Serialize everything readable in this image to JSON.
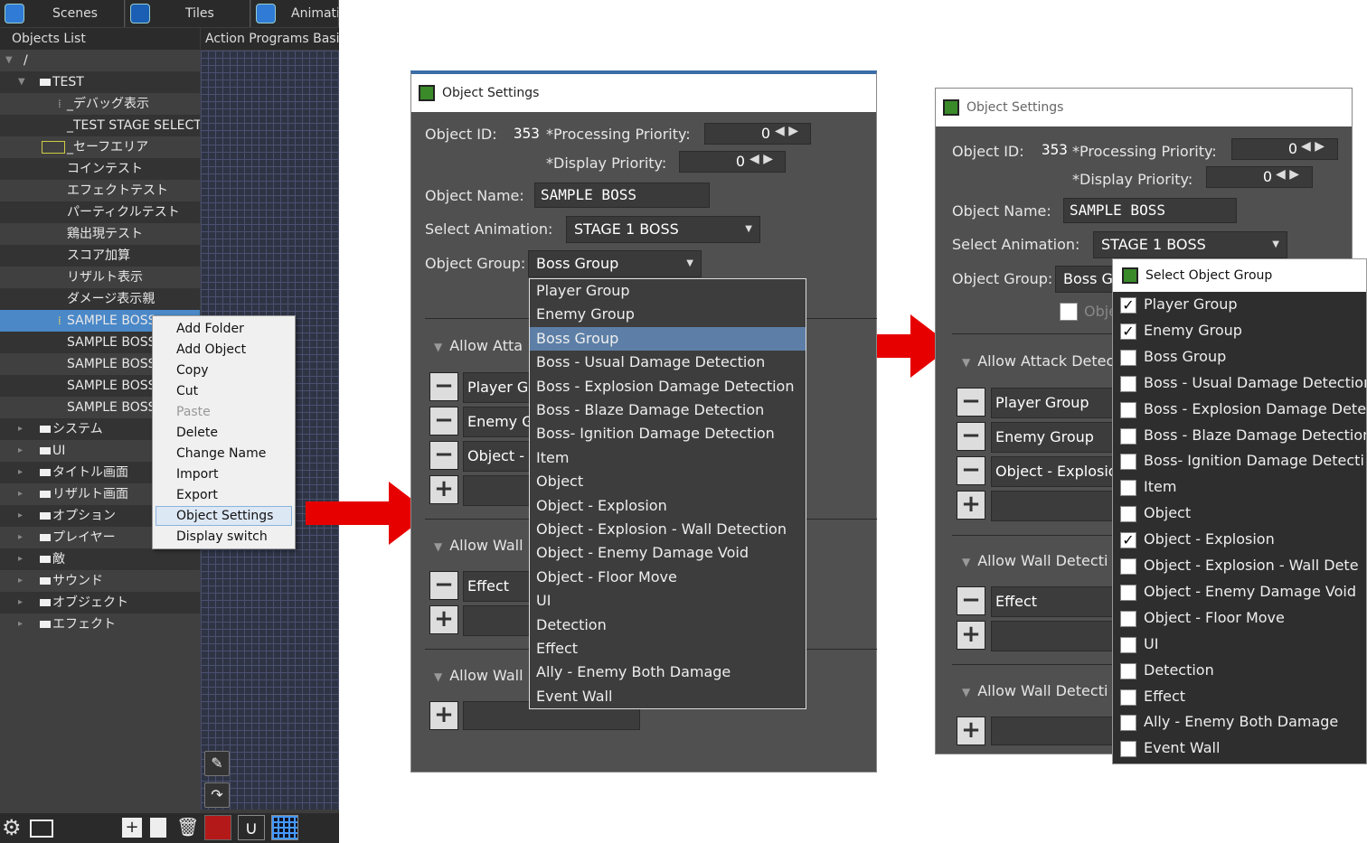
{
  "editor": {
    "tabs": [
      "Scenes",
      "Tiles",
      "Animatio"
    ],
    "objects_list_header": "Objects List",
    "action_programs_header": "Action Programs",
    "basic_header": "Basic",
    "root": "/",
    "tree": [
      "TEST",
      "_デバッグ表示",
      "_TEST STAGE SELECT",
      "_セーフエリア",
      "コインテスト",
      "エフェクトテスト",
      "パーティクルテスト",
      "鶏出現テスト",
      "スコア加算",
      "リザルト表示",
      "ダメージ表示親",
      "SAMPLE BOSS",
      "SAMPLE BOSS",
      "SAMPLE BOSS",
      "SAMPLE BOSS",
      "SAMPLE BOSS",
      "システム",
      "UI",
      "タイトル画面",
      "リザルト画面",
      "オプション",
      "プレイヤー",
      "敵",
      "サウンド",
      "オブジェクト",
      "エフェクト"
    ],
    "context_menu": [
      "Add Folder",
      "Add Object",
      "Copy",
      "Cut",
      "Paste",
      "Delete",
      "Change Name",
      "Import",
      "Export",
      "Object Settings",
      "Display switch"
    ]
  },
  "dialog1": {
    "title": "Object Settings",
    "object_id_label": "Object ID:",
    "object_id": "353",
    "processing_priority_label": "*Processing Priority:",
    "processing_priority": "0",
    "display_priority_label": "*Display Priority:",
    "display_priority": "0",
    "object_name_label": "Object Name:",
    "object_name": "SAMPLE BOSS",
    "select_animation_label": "Select Animation:",
    "select_animation": "STAGE 1 BOSS",
    "object_group_label": "Object Group:",
    "object_group": "Boss Group",
    "section_attack": "Allow Atta",
    "section_wall1": "Allow Wall",
    "section_wall2": "Allow Wall",
    "attack_items": [
      "Player Gr",
      "Enemy Gr",
      "Object -"
    ],
    "wall_items": [
      "Effect"
    ],
    "group_options": [
      "Player Group",
      "Enemy Group",
      "Boss Group",
      "Boss - Usual Damage Detection",
      "Boss - Explosion Damage Detection",
      "Boss - Blaze Damage Detection",
      "Boss- Ignition Damage Detection",
      "Item",
      "Object",
      "Object - Explosion",
      "Object - Explosion - Wall Detection",
      "Object - Enemy Damage Void",
      "Object - Floor Move",
      "UI",
      "Detection",
      "Effect",
      "Ally - Enemy Both Damage",
      "Event Wall"
    ]
  },
  "dialog2": {
    "title": "Object Settings",
    "object_id_label": "Object ID:",
    "object_id": "353",
    "processing_priority_label": "*Processing Priority:",
    "processing_priority": "0",
    "display_priority_label": "*Display Priority:",
    "display_priority": "0",
    "object_name_label": "Object Name:",
    "object_name": "SAMPLE BOSS",
    "select_animation_label": "Select Animation:",
    "select_animation": "STAGE 1 BOSS",
    "object_group_label": "Object Group:",
    "object_group": "Boss G",
    "obj_checkbox_label": "Obje",
    "section_attack": "Allow Attack Detec",
    "section_wall1": "Allow Wall Detecti",
    "section_wall2": "Allow Wall Detecti",
    "attack_items": [
      "Player Group",
      "Enemy Group",
      "Object - Explosio"
    ],
    "wall_items": [
      "Effect"
    ],
    "select_group_title": "Select Object Group",
    "group_options": [
      {
        "label": "Player Group",
        "checked": true
      },
      {
        "label": "Enemy Group",
        "checked": true
      },
      {
        "label": "Boss Group",
        "checked": false
      },
      {
        "label": "Boss - Usual Damage Detection",
        "checked": false
      },
      {
        "label": "Boss - Explosion Damage Detec",
        "checked": false
      },
      {
        "label": "Boss - Blaze Damage Detection",
        "checked": false
      },
      {
        "label": "Boss- Ignition Damage Detecti",
        "checked": false
      },
      {
        "label": "Item",
        "checked": false
      },
      {
        "label": "Object",
        "checked": false
      },
      {
        "label": "Object - Explosion",
        "checked": true
      },
      {
        "label": "Object - Explosion - Wall Dete",
        "checked": false
      },
      {
        "label": "Object - Enemy Damage Void",
        "checked": false
      },
      {
        "label": "Object - Floor Move",
        "checked": false
      },
      {
        "label": "UI",
        "checked": false
      },
      {
        "label": "Detection",
        "checked": false
      },
      {
        "label": "Effect",
        "checked": false
      },
      {
        "label": "Ally - Enemy Both Damage",
        "checked": false
      },
      {
        "label": "Event Wall",
        "checked": false
      }
    ]
  },
  "colors": {
    "arrow": "#e60000",
    "selection": "#4a88c8",
    "list_selection": "#5d7fa7"
  }
}
